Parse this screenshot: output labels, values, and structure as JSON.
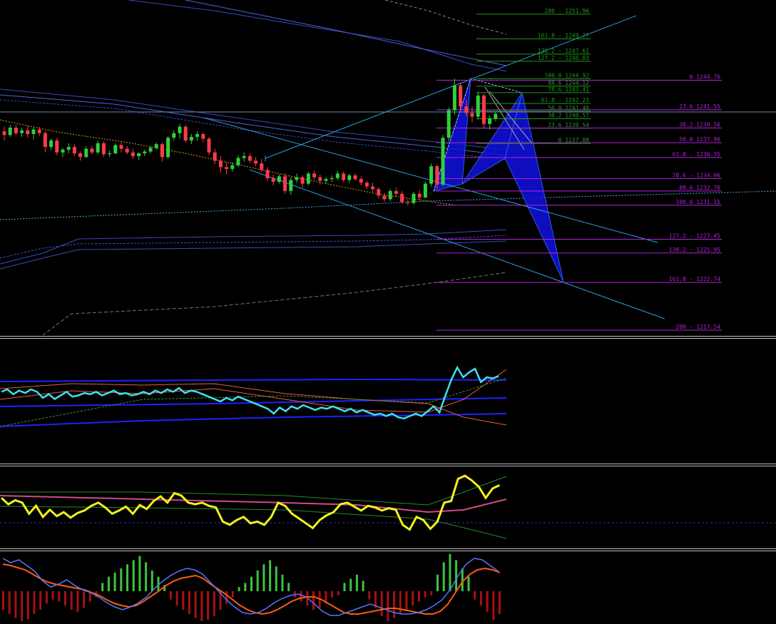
{
  "colors": {
    "background": "#000000",
    "bull_candle": "#2fd13b",
    "bear_candle": "#ff3b4a",
    "fib_retrace": "#1f9a1f",
    "fib_extension": "#b024d8",
    "channel": "#2a9fe0",
    "harmonic": "#1010e0",
    "rsi_main": "#3fe0ef",
    "cci_main": "#f2f21a",
    "macd_signal": "#ff5a12",
    "macd_main": "#5577ff",
    "hist_up": "#3fc23f",
    "hist_down": "#a51111",
    "separator": "#c0c0c0"
  },
  "fib_levels_green": [
    {
      "label": "200 - 1251.96",
      "price": 1251.96
    },
    {
      "label": "161.8 - 1249.27",
      "price": 1249.27
    },
    {
      "label": "138.2 - 1247.61",
      "price": 1247.61
    },
    {
      "label": "127.2 - 1246.83",
      "price": 1246.83
    },
    {
      "label": "100.0 1244.92",
      "price": 1244.92
    },
    {
      "label": "88.6 1244.12",
      "price": 1244.12
    },
    {
      "label": "78.6 1243.41",
      "price": 1243.41
    },
    {
      "label": "61.8 - 1242.23",
      "price": 1242.23
    },
    {
      "label": "50.0 1241.40",
      "price": 1241.4
    },
    {
      "label": "38.2 1240.57",
      "price": 1240.57
    },
    {
      "label": "23.6 1239.54",
      "price": 1239.54
    },
    {
      "label": "0 1237.88",
      "price": 1237.88
    }
  ],
  "fib_levels_purple": [
    {
      "label": "0 1244.76",
      "price": 1244.76
    },
    {
      "label": "23.6 1241.55",
      "price": 1241.55
    },
    {
      "label": "38.2 1239.56",
      "price": 1239.56
    },
    {
      "label": "50.0 1237.96",
      "price": 1237.96
    },
    {
      "label": "61.8 - 1236.35",
      "price": 1236.35
    },
    {
      "label": "78.6 - 1234.06",
      "price": 1234.06
    },
    {
      "label": "88.6 1232.70",
      "price": 1232.7
    },
    {
      "label": "100.0 1231.15",
      "price": 1231.15
    },
    {
      "label": "127.2 - 1227.45",
      "price": 1227.45
    },
    {
      "label": "138.2 - 1225.95",
      "price": 1225.95
    },
    {
      "label": "161.8 - 1222.74",
      "price": 1222.74
    },
    {
      "label": "200 - 1217.54",
      "price": 1217.54
    }
  ],
  "chart_data": [
    {
      "type": "candlestick",
      "ylim": [
        1217,
        1253.5
      ],
      "grid": false,
      "candles_ohlc": [
        [
          1239.2,
          1239.7,
          1238.2,
          1238.8
        ],
        [
          1238.8,
          1239.9,
          1238.6,
          1239.6
        ],
        [
          1239.6,
          1239.9,
          1238.8,
          1239.0
        ],
        [
          1239.0,
          1239.6,
          1238.6,
          1239.3
        ],
        [
          1239.3,
          1239.8,
          1238.5,
          1238.9
        ],
        [
          1238.9,
          1239.6,
          1238.3,
          1239.4
        ],
        [
          1239.4,
          1239.7,
          1238.7,
          1239.0
        ],
        [
          1239.0,
          1239.2,
          1236.9,
          1237.5
        ],
        [
          1237.5,
          1238.4,
          1237.2,
          1238.2
        ],
        [
          1238.2,
          1238.5,
          1236.6,
          1236.9
        ],
        [
          1236.9,
          1237.4,
          1236.4,
          1237.2
        ],
        [
          1237.2,
          1237.9,
          1236.8,
          1237.5
        ],
        [
          1237.5,
          1237.8,
          1236.5,
          1236.8
        ],
        [
          1236.8,
          1237.0,
          1236.0,
          1236.4
        ],
        [
          1236.4,
          1237.6,
          1236.3,
          1237.3
        ],
        [
          1237.3,
          1237.6,
          1236.7,
          1236.9
        ],
        [
          1236.9,
          1238.2,
          1236.7,
          1237.9
        ],
        [
          1237.9,
          1238.1,
          1236.4,
          1236.7
        ],
        [
          1236.7,
          1237.1,
          1236.4,
          1236.8
        ],
        [
          1236.8,
          1237.9,
          1236.7,
          1237.7
        ],
        [
          1237.7,
          1238.0,
          1236.9,
          1237.3
        ],
        [
          1237.3,
          1237.6,
          1236.7,
          1236.9
        ],
        [
          1236.9,
          1237.3,
          1236.2,
          1236.5
        ],
        [
          1236.5,
          1236.9,
          1236.1,
          1236.8
        ],
        [
          1236.8,
          1237.2,
          1236.5,
          1237.0
        ],
        [
          1237.0,
          1237.6,
          1236.8,
          1237.4
        ],
        [
          1237.4,
          1238.0,
          1237.2,
          1237.8
        ],
        [
          1237.8,
          1238.0,
          1235.9,
          1236.4
        ],
        [
          1236.4,
          1238.7,
          1236.2,
          1238.5
        ],
        [
          1238.5,
          1239.3,
          1238.2,
          1239.0
        ],
        [
          1239.0,
          1240.0,
          1238.4,
          1239.7
        ],
        [
          1239.7,
          1239.9,
          1238.0,
          1238.2
        ],
        [
          1238.2,
          1238.9,
          1237.8,
          1238.6
        ],
        [
          1238.6,
          1239.2,
          1238.2,
          1238.9
        ],
        [
          1238.9,
          1239.1,
          1238.0,
          1238.4
        ],
        [
          1238.4,
          1238.6,
          1236.6,
          1236.9
        ],
        [
          1236.9,
          1237.3,
          1235.6,
          1236.0
        ],
        [
          1236.0,
          1236.5,
          1234.7,
          1235.3
        ],
        [
          1235.3,
          1235.8,
          1234.5,
          1235.1
        ],
        [
          1235.1,
          1235.8,
          1234.8,
          1235.5
        ],
        [
          1235.5,
          1236.6,
          1235.3,
          1236.3
        ],
        [
          1236.3,
          1236.9,
          1235.9,
          1236.5
        ],
        [
          1236.5,
          1236.8,
          1235.8,
          1236.0
        ],
        [
          1236.0,
          1236.4,
          1235.4,
          1235.7
        ],
        [
          1235.7,
          1236.2,
          1234.8,
          1235.0
        ],
        [
          1235.0,
          1235.3,
          1233.8,
          1234.1
        ],
        [
          1234.1,
          1234.5,
          1233.3,
          1233.7
        ],
        [
          1233.7,
          1234.5,
          1233.5,
          1234.3
        ],
        [
          1234.3,
          1234.6,
          1232.4,
          1232.7
        ],
        [
          1232.7,
          1234.2,
          1232.3,
          1233.9
        ],
        [
          1233.9,
          1234.6,
          1233.6,
          1234.2
        ],
        [
          1234.2,
          1234.4,
          1233.1,
          1233.5
        ],
        [
          1233.5,
          1234.8,
          1233.3,
          1234.6
        ],
        [
          1234.6,
          1234.9,
          1233.9,
          1234.2
        ],
        [
          1234.2,
          1234.5,
          1233.4,
          1233.8
        ],
        [
          1233.8,
          1234.2,
          1233.5,
          1234.0
        ],
        [
          1234.0,
          1234.4,
          1233.7,
          1234.1
        ],
        [
          1234.1,
          1234.9,
          1233.9,
          1234.6
        ],
        [
          1234.6,
          1234.8,
          1233.7,
          1233.9
        ],
        [
          1233.9,
          1234.6,
          1233.6,
          1234.4
        ],
        [
          1234.4,
          1234.6,
          1233.8,
          1234.0
        ],
        [
          1234.0,
          1234.3,
          1233.3,
          1233.6
        ],
        [
          1233.6,
          1233.8,
          1232.9,
          1233.2
        ],
        [
          1233.2,
          1233.6,
          1232.6,
          1232.9
        ],
        [
          1232.9,
          1233.1,
          1231.9,
          1232.2
        ],
        [
          1232.2,
          1232.5,
          1231.5,
          1231.8
        ],
        [
          1231.8,
          1232.9,
          1231.6,
          1232.7
        ],
        [
          1232.7,
          1233.1,
          1232.1,
          1232.4
        ],
        [
          1232.4,
          1232.7,
          1231.3,
          1231.5
        ],
        [
          1231.5,
          1231.8,
          1231.15,
          1231.4
        ],
        [
          1231.4,
          1232.6,
          1231.2,
          1232.4
        ],
        [
          1232.4,
          1232.8,
          1231.7,
          1232.0
        ],
        [
          1232.0,
          1233.7,
          1231.9,
          1233.5
        ],
        [
          1233.5,
          1235.7,
          1233.2,
          1235.4
        ],
        [
          1235.4,
          1235.6,
          1232.9,
          1233.4
        ],
        [
          1233.4,
          1238.8,
          1233.2,
          1238.5
        ],
        [
          1238.5,
          1241.8,
          1238.1,
          1241.5
        ],
        [
          1241.5,
          1244.92,
          1241.0,
          1244.2
        ],
        [
          1244.2,
          1244.5,
          1241.3,
          1241.9
        ],
        [
          1241.9,
          1242.6,
          1240.8,
          1241.2
        ],
        [
          1241.2,
          1241.9,
          1240.2,
          1240.8
        ],
        [
          1240.8,
          1243.5,
          1240.5,
          1243.1
        ],
        [
          1243.1,
          1243.3,
          1239.6,
          1240.0
        ],
        [
          1240.0,
          1240.9,
          1239.4,
          1240.6
        ],
        [
          1240.6,
          1241.3,
          1240.3,
          1241.1
        ]
      ]
    },
    {
      "type": "line",
      "ylim": [
        0,
        100
      ],
      "series": [
        {
          "values": [
            58,
            60,
            56,
            59,
            57,
            60,
            58,
            53,
            56,
            52,
            55,
            58,
            54,
            55,
            57,
            56,
            58,
            55,
            57,
            59,
            56,
            57,
            55,
            56,
            58,
            56,
            59,
            57,
            60,
            58,
            61,
            57,
            59,
            58,
            56,
            54,
            52,
            50,
            53,
            51,
            54,
            52,
            50,
            48,
            46,
            44,
            40,
            45,
            42,
            46,
            44,
            47,
            45,
            43,
            45,
            44,
            46,
            44,
            42,
            44,
            41,
            43,
            41,
            39,
            40,
            38,
            40,
            37,
            36,
            38,
            40,
            38,
            42,
            46,
            41,
            55,
            68,
            78,
            70,
            74,
            77,
            66,
            70,
            69,
            71
          ]
        }
      ]
    },
    {
      "type": "line",
      "ylim": [
        -250,
        250
      ],
      "series": [
        {
          "values": [
            60,
            20,
            45,
            30,
            -40,
            10,
            -60,
            -15,
            -55,
            -30,
            -65,
            -35,
            -20,
            10,
            30,
            0,
            -40,
            -20,
            5,
            -40,
            15,
            -10,
            40,
            70,
            30,
            90,
            75,
            30,
            20,
            30,
            10,
            0,
            -90,
            -110,
            -80,
            -60,
            -100,
            -90,
            -110,
            -60,
            30,
            10,
            -40,
            -70,
            -100,
            -130,
            -80,
            -50,
            -30,
            20,
            30,
            5,
            -20,
            10,
            0,
            -20,
            -5,
            -15,
            -110,
            -140,
            -60,
            -80,
            -135,
            -90,
            30,
            40,
            180,
            200,
            170,
            130,
            60,
            120,
            140
          ]
        }
      ]
    },
    {
      "type": "bar",
      "series": [
        {
          "values": [
            -18,
            -22,
            -26,
            -30,
            -27,
            -22,
            -18,
            -12,
            -8,
            -10,
            -14,
            -18,
            -20,
            -16,
            -10,
            -6,
            8,
            14,
            18,
            22,
            26,
            30,
            34,
            28,
            20,
            14,
            6,
            -8,
            -14,
            -18,
            -22,
            -26,
            -30,
            -28,
            -24,
            -18,
            -12,
            -6,
            4,
            8,
            14,
            20,
            26,
            30,
            24,
            16,
            8,
            -6,
            -10,
            -14,
            -18,
            -16,
            -12,
            -6,
            -4,
            8,
            12,
            16,
            10,
            -8,
            -16,
            -24,
            -30,
            -26,
            -22,
            -18,
            -14,
            -10,
            -6,
            -4,
            16,
            28,
            36,
            30,
            22,
            14,
            -8,
            -14,
            -20,
            -28,
            -22
          ]
        },
        {
          "values": [
            80,
            78,
            75,
            72,
            66,
            60,
            55,
            52,
            50,
            48,
            46,
            44,
            40,
            36,
            30,
            25,
            22,
            20,
            22,
            28,
            35,
            42,
            50,
            56,
            60,
            62,
            64,
            60,
            52,
            45,
            38,
            30,
            22,
            16,
            12,
            10,
            12,
            16,
            22,
            28,
            32,
            34,
            34,
            30,
            24,
            18,
            12,
            10,
            10,
            12,
            14,
            16,
            18,
            18,
            16,
            14,
            12,
            10,
            10,
            14,
            24,
            40,
            56,
            66,
            72,
            74,
            72,
            68
          ]
        },
        {
          "values": [
            88,
            82,
            86,
            78,
            70,
            56,
            48,
            52,
            58,
            50,
            44,
            40,
            34,
            26,
            20,
            16,
            20,
            26,
            34,
            46,
            56,
            64,
            70,
            74,
            72,
            66,
            54,
            42,
            30,
            20,
            12,
            10,
            12,
            18,
            26,
            32,
            36,
            38,
            34,
            24,
            14,
            8,
            8,
            12,
            16,
            20,
            24,
            20,
            16,
            12,
            10,
            10,
            12,
            16,
            22,
            30,
            44,
            64,
            80,
            88,
            86,
            78,
            70
          ]
        }
      ]
    }
  ]
}
